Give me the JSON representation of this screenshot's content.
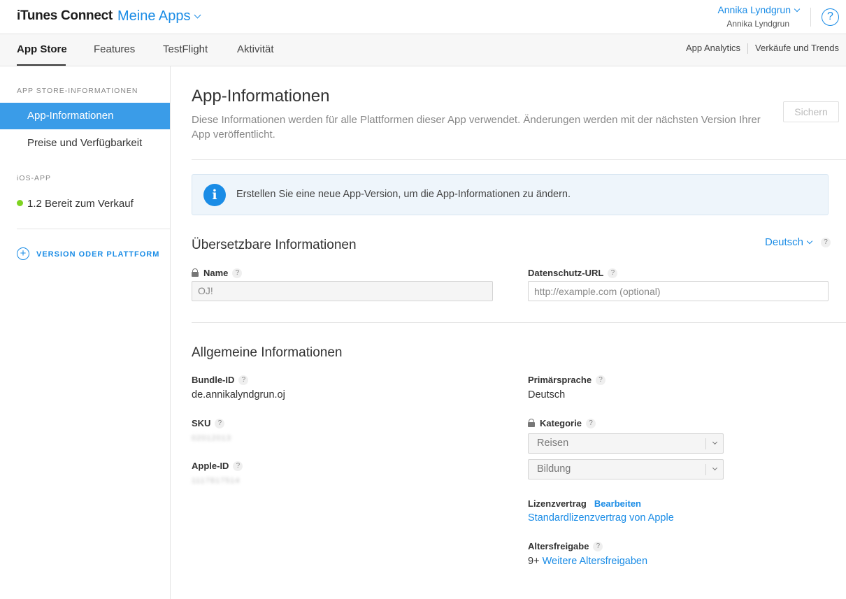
{
  "header": {
    "brand": "iTunes Connect",
    "section": "Meine Apps",
    "user_name": "Annika Lyndgrun",
    "user_sub": "Annika Lyndgrun",
    "help_label": "?"
  },
  "nav": {
    "tabs": [
      {
        "label": "App Store"
      },
      {
        "label": "Features"
      },
      {
        "label": "TestFlight"
      },
      {
        "label": "Aktivität"
      }
    ],
    "right": [
      {
        "label": "App Analytics"
      },
      {
        "label": "Verkäufe und Trends"
      }
    ]
  },
  "sidebar": {
    "heading_store": "APP STORE-INFORMATIONEN",
    "items": [
      {
        "label": "App-Informationen"
      },
      {
        "label": "Preise und Verfügbarkeit"
      }
    ],
    "heading_ios": "iOS-APP",
    "version_item": "1.2 Bereit zum Verkauf",
    "add_label": "VERSION ODER PLATTFORM",
    "add_icon": "+"
  },
  "main": {
    "title": "App-Informationen",
    "description": "Diese Informationen werden für alle Plattformen dieser App verwendet. Änderungen werden mit der nächsten Version Ihrer App veröffentlicht.",
    "save_label": "Sichern",
    "info_icon": "i",
    "info_text": "Erstellen Sie eine neue App-Version, um die App-Informationen zu ändern.",
    "translatable": {
      "title": "Übersetzbare Informationen",
      "language": "Deutsch",
      "name_label": "Name",
      "name_value": "OJ!",
      "privacy_label": "Datenschutz-URL",
      "privacy_placeholder": "http://example.com (optional)"
    },
    "general": {
      "title": "Allgemeine Informationen",
      "bundle_label": "Bundle-ID",
      "bundle_value": "de.annikalyndgrun.oj",
      "sku_label": "SKU",
      "sku_value": "02012013",
      "apple_id_label": "Apple-ID",
      "apple_id_value": "1117817514",
      "primary_lang_label": "Primärsprache",
      "primary_lang_value": "Deutsch",
      "category_label": "Kategorie",
      "category_primary": "Reisen",
      "category_secondary": "Bildung",
      "license_label": "Lizenzvertrag",
      "license_edit": "Bearbeiten",
      "license_link": "Standardlizenzvertrag von Apple",
      "age_label": "Altersfreigabe",
      "age_value": "9+",
      "age_link": "Weitere Altersfreigaben"
    },
    "help_mark": "?"
  },
  "colors": {
    "accent": "#1a8ce6",
    "sidebar_active": "#3a9ce8",
    "status_ready": "#7ed321"
  }
}
